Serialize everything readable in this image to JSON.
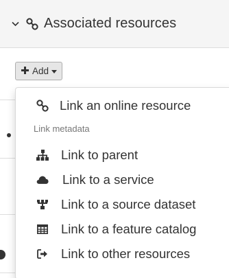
{
  "panel": {
    "title": "Associated resources",
    "chevron_icon": "chevron-down-icon",
    "title_icon": "link-icon"
  },
  "add_button": {
    "label": "Add",
    "icon": "plus-icon"
  },
  "menu": {
    "first_item": {
      "label": "Link an online resource",
      "icon": "link-icon"
    },
    "header": "Link metadata",
    "items": [
      {
        "label": "Link to parent",
        "icon": "sitemap-icon"
      },
      {
        "label": "Link to a service",
        "icon": "cloud-icon"
      },
      {
        "label": "Link to a source dataset",
        "icon": "cubes-icon"
      },
      {
        "label": "Link to a feature catalog",
        "icon": "table-icon"
      },
      {
        "label": "Link to other resources",
        "icon": "share-icon"
      }
    ]
  },
  "colors": {
    "text": "#333333",
    "muted": "#777777",
    "heading_bg": "#f5f5f5",
    "button_bg": "#e6e6e6"
  }
}
